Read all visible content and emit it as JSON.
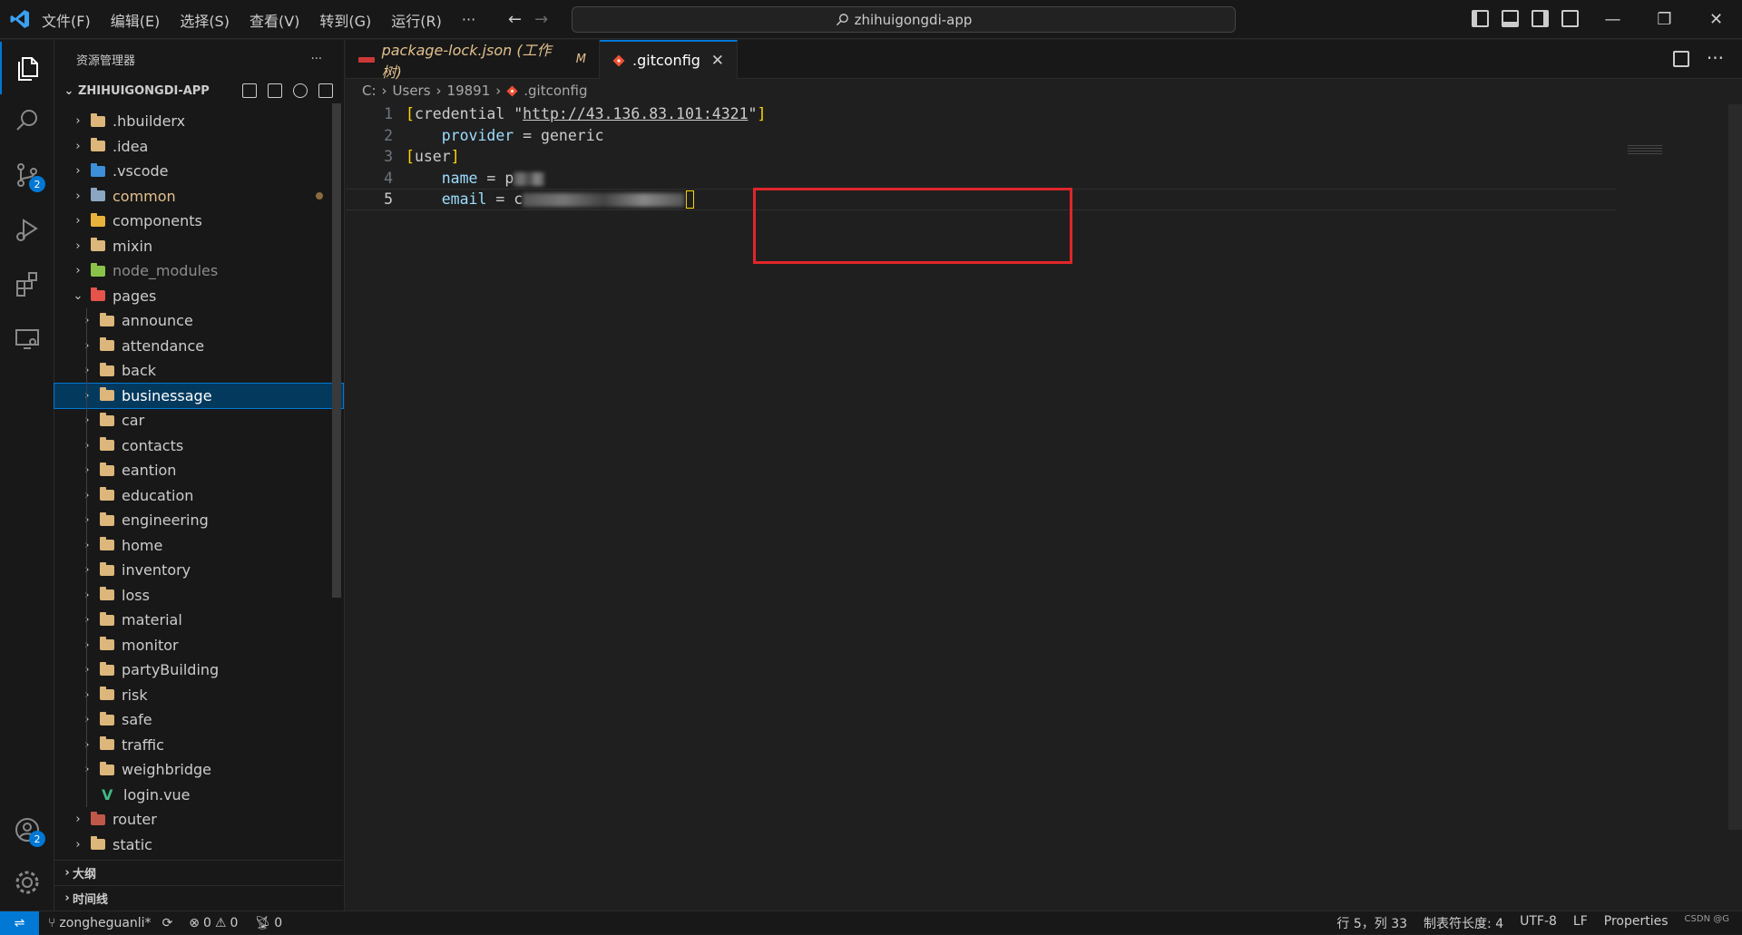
{
  "menu": [
    "文件(F)",
    "编辑(E)",
    "选择(S)",
    "查看(V)",
    "转到(G)",
    "运行(R)",
    "···"
  ],
  "title_search": "zhihuigongdi-app",
  "sidebar": {
    "title": "资源管理器",
    "more": "···",
    "project": "ZHIHUIGONGDI-APP",
    "tree": [
      {
        "label": ".hbuilderx",
        "depth": 0,
        "open": false,
        "color": "#dcb67a",
        "text_color": "#cccccc"
      },
      {
        "label": ".idea",
        "depth": 0,
        "open": false,
        "color": "#dcb67a",
        "text_color": "#cccccc"
      },
      {
        "label": ".vscode",
        "depth": 0,
        "open": false,
        "color": "#3c8fd8",
        "text_color": "#cccccc"
      },
      {
        "label": "common",
        "depth": 0,
        "open": false,
        "color": "#8aa6c1",
        "text_color": "#e2c08d",
        "modified": true
      },
      {
        "label": "components",
        "depth": 0,
        "open": false,
        "color": "#e8b33c",
        "text_color": "#cccccc"
      },
      {
        "label": "mixin",
        "depth": 0,
        "open": false,
        "color": "#dcb67a",
        "text_color": "#cccccc"
      },
      {
        "label": "node_modules",
        "depth": 0,
        "open": false,
        "color": "#8bc34a",
        "text_color": "#8c8c8c"
      },
      {
        "label": "pages",
        "depth": 0,
        "open": true,
        "color": "#e5534b",
        "text_color": "#cccccc"
      },
      {
        "label": "announce",
        "depth": 1,
        "open": false,
        "color": "#dcb67a",
        "text_color": "#cccccc"
      },
      {
        "label": "attendance",
        "depth": 1,
        "open": false,
        "color": "#dcb67a",
        "text_color": "#cccccc"
      },
      {
        "label": "back",
        "depth": 1,
        "open": false,
        "color": "#dcb67a",
        "text_color": "#cccccc"
      },
      {
        "label": "businessage",
        "depth": 1,
        "open": false,
        "color": "#dcb67a",
        "text_color": "#ffffff",
        "selected": true
      },
      {
        "label": "car",
        "depth": 1,
        "open": false,
        "color": "#dcb67a",
        "text_color": "#cccccc"
      },
      {
        "label": "contacts",
        "depth": 1,
        "open": false,
        "color": "#dcb67a",
        "text_color": "#cccccc"
      },
      {
        "label": "eantion",
        "depth": 1,
        "open": false,
        "color": "#dcb67a",
        "text_color": "#cccccc"
      },
      {
        "label": "education",
        "depth": 1,
        "open": false,
        "color": "#dcb67a",
        "text_color": "#cccccc"
      },
      {
        "label": "engineering",
        "depth": 1,
        "open": false,
        "color": "#dcb67a",
        "text_color": "#cccccc"
      },
      {
        "label": "home",
        "depth": 1,
        "open": false,
        "color": "#dcb67a",
        "text_color": "#cccccc"
      },
      {
        "label": "inventory",
        "depth": 1,
        "open": false,
        "color": "#dcb67a",
        "text_color": "#cccccc"
      },
      {
        "label": "loss",
        "depth": 1,
        "open": false,
        "color": "#dcb67a",
        "text_color": "#cccccc"
      },
      {
        "label": "material",
        "depth": 1,
        "open": false,
        "color": "#dcb67a",
        "text_color": "#cccccc"
      },
      {
        "label": "monitor",
        "depth": 1,
        "open": false,
        "color": "#dcb67a",
        "text_color": "#cccccc"
      },
      {
        "label": "partyBuilding",
        "depth": 1,
        "open": false,
        "color": "#dcb67a",
        "text_color": "#cccccc"
      },
      {
        "label": "risk",
        "depth": 1,
        "open": false,
        "color": "#dcb67a",
        "text_color": "#cccccc"
      },
      {
        "label": "safe",
        "depth": 1,
        "open": false,
        "color": "#dcb67a",
        "text_color": "#cccccc"
      },
      {
        "label": "traffic",
        "depth": 1,
        "open": false,
        "color": "#dcb67a",
        "text_color": "#cccccc"
      },
      {
        "label": "weighbridge",
        "depth": 1,
        "open": false,
        "color": "#dcb67a",
        "text_color": "#cccccc"
      },
      {
        "label": "login.vue",
        "depth": 1,
        "file": true,
        "text_color": "#cccccc"
      },
      {
        "label": "router",
        "depth": 0,
        "open": false,
        "color": "#c0584a",
        "text_color": "#cccccc"
      },
      {
        "label": "static",
        "depth": 0,
        "open": false,
        "color": "#dcb67a",
        "text_color": "#cccccc"
      }
    ],
    "outline": "大纲",
    "timeline": "时间线"
  },
  "tabs": [
    {
      "label": "package-lock.json (工作树)",
      "modified": "M"
    },
    {
      "label": ".gitconfig",
      "close": "✕"
    }
  ],
  "breadcrumb": [
    "C:",
    "Users",
    "19891",
    ".gitconfig"
  ],
  "code": {
    "line1": {
      "n": "1",
      "a": "[credential \"",
      "url": "http://43.136.83.101:4321",
      "b": "\"]"
    },
    "line2": {
      "n": "2",
      "key": "provider",
      "eq": " = ",
      "val": "generic"
    },
    "line3": {
      "n": "3",
      "open": "[",
      "section": "user",
      "close": "]"
    },
    "line4": {
      "n": "4",
      "key": "name",
      "eq": " = ",
      "val": "p"
    },
    "line5": {
      "n": "5",
      "key": "email",
      "eq": " = ",
      "val": "c"
    }
  },
  "status": {
    "branch": "zongheguanli*",
    "errors": "0",
    "warnings": "0",
    "ports": "0",
    "position": "行 5，列 33",
    "tabsize": "制表符长度: 4",
    "encoding": "UTF-8",
    "eol": "LF",
    "language": "Properties",
    "watermark": "CSDN @G"
  },
  "badges": {
    "scm": "2",
    "accounts": "2"
  },
  "colors": {
    "accent": "#0078d4",
    "highlight_box": "#e0262a",
    "bracket": "#ffd700",
    "key": "#9cdcfe",
    "modified": "#e2c08d"
  }
}
